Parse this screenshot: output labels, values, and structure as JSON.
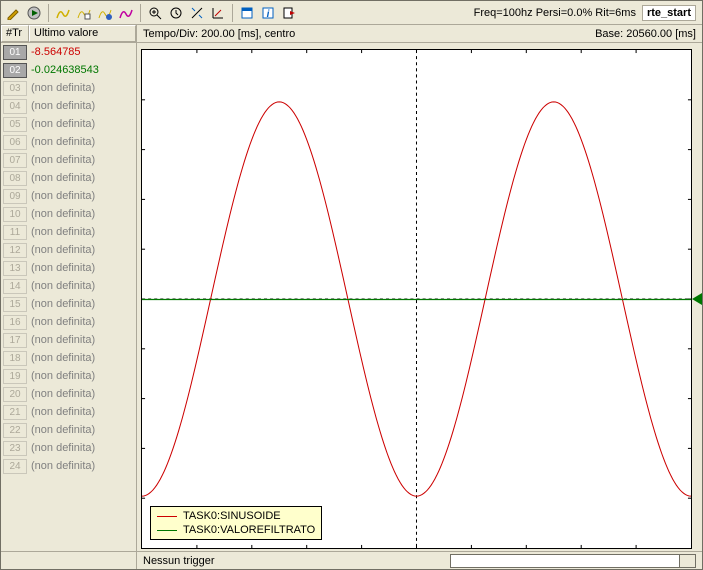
{
  "toolbar": {
    "icons": [
      "pencil-icon",
      "play-icon",
      "chart-yellow-icon",
      "chart-config-icon",
      "chart-blue-icon",
      "chart-magenta-icon",
      "zoom-in-icon",
      "history-icon",
      "cursor-measure-icon",
      "axes-icon",
      "window-icon",
      "info-icon",
      "exit-icon"
    ],
    "status_text": "Freq=100hz Persi=0.0% Rit=6ms",
    "rte_label": "rte_start"
  },
  "header": {
    "tr_col": "#Tr",
    "val_col": "Ultimo valore",
    "timebase": "Tempo/Div: 200.00 [ms], centro",
    "base": "Base: 20560.00 [ms]"
  },
  "tracks": [
    {
      "num": "01",
      "val": "-8.564785",
      "cls": "red",
      "active": true
    },
    {
      "num": "02",
      "val": "-0.024638543",
      "cls": "green",
      "active": true
    },
    {
      "num": "03",
      "val": "(non definita)",
      "cls": "gray",
      "active": false
    },
    {
      "num": "04",
      "val": "(non definita)",
      "cls": "gray",
      "active": false
    },
    {
      "num": "05",
      "val": "(non definita)",
      "cls": "gray",
      "active": false
    },
    {
      "num": "06",
      "val": "(non definita)",
      "cls": "gray",
      "active": false
    },
    {
      "num": "07",
      "val": "(non definita)",
      "cls": "gray",
      "active": false
    },
    {
      "num": "08",
      "val": "(non definita)",
      "cls": "gray",
      "active": false
    },
    {
      "num": "09",
      "val": "(non definita)",
      "cls": "gray",
      "active": false
    },
    {
      "num": "10",
      "val": "(non definita)",
      "cls": "gray",
      "active": false
    },
    {
      "num": "11",
      "val": "(non definita)",
      "cls": "gray",
      "active": false
    },
    {
      "num": "12",
      "val": "(non definita)",
      "cls": "gray",
      "active": false
    },
    {
      "num": "13",
      "val": "(non definita)",
      "cls": "gray",
      "active": false
    },
    {
      "num": "14",
      "val": "(non definita)",
      "cls": "gray",
      "active": false
    },
    {
      "num": "15",
      "val": "(non definita)",
      "cls": "gray",
      "active": false
    },
    {
      "num": "16",
      "val": "(non definita)",
      "cls": "gray",
      "active": false
    },
    {
      "num": "17",
      "val": "(non definita)",
      "cls": "gray",
      "active": false
    },
    {
      "num": "18",
      "val": "(non definita)",
      "cls": "gray",
      "active": false
    },
    {
      "num": "19",
      "val": "(non definita)",
      "cls": "gray",
      "active": false
    },
    {
      "num": "20",
      "val": "(non definita)",
      "cls": "gray",
      "active": false
    },
    {
      "num": "21",
      "val": "(non definita)",
      "cls": "gray",
      "active": false
    },
    {
      "num": "22",
      "val": "(non definita)",
      "cls": "gray",
      "active": false
    },
    {
      "num": "23",
      "val": "(non definita)",
      "cls": "gray",
      "active": false
    },
    {
      "num": "24",
      "val": "(non definita)",
      "cls": "gray",
      "active": false
    }
  ],
  "legend": {
    "series1": "TASK0:SINUSOIDE",
    "series2": "TASK0:VALOREFILTRATO"
  },
  "status": {
    "trigger": "Nessun trigger"
  },
  "chart_data": {
    "type": "line",
    "timebase_ms_per_div": 200.0,
    "divisions_x": 10,
    "x_range_ms": [
      0,
      2000
    ],
    "base_time_ms": 20560.0,
    "cursor_x_ms": 1000,
    "series": [
      {
        "name": "TASK0:SINUSOIDE",
        "color": "#cc0000",
        "amplitude": 10,
        "period_ms": 1000,
        "phase_ms": 0,
        "current_value": -8.564785
      },
      {
        "name": "TASK0:VALOREFILTRATO",
        "color": "#007700",
        "flat_value": -0.024638543,
        "current_value": -0.024638543
      }
    ],
    "y_range": [
      -12,
      12
    ]
  }
}
